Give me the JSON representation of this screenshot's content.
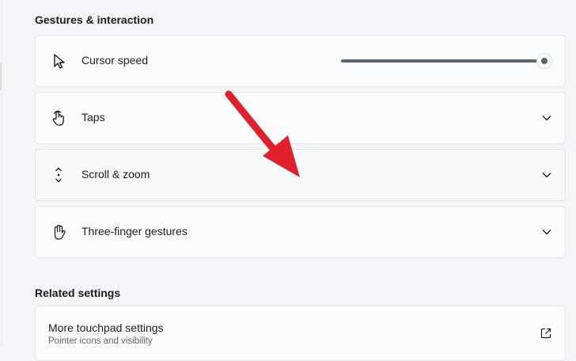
{
  "gestures": {
    "section_title": "Gestures & interaction",
    "items": [
      {
        "label": "Cursor speed",
        "icon": "cursor-icon"
      },
      {
        "label": "Taps",
        "icon": "tap-icon"
      },
      {
        "label": "Scroll & zoom",
        "icon": "scroll-icon"
      },
      {
        "label": "Three-finger gestures",
        "icon": "hand-icon"
      }
    ],
    "cursor_speed_level": 1.0
  },
  "related": {
    "section_title": "Related settings",
    "items": [
      {
        "title": "More touchpad settings",
        "subtitle": "Pointer icons and visibility",
        "icon": "external-link-icon"
      }
    ]
  },
  "colors": {
    "annotation_arrow": "#e0212b",
    "slider_fill": "#5a6670"
  }
}
